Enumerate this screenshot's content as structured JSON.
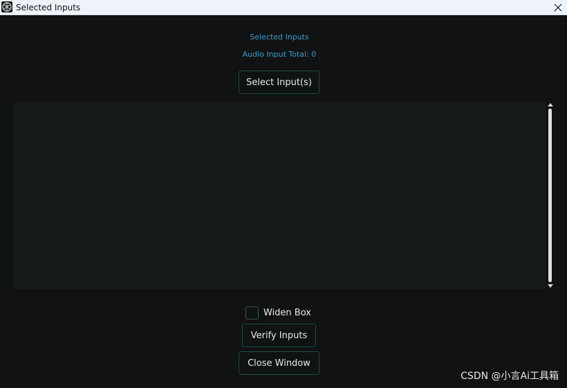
{
  "window": {
    "title": "Selected Inputs"
  },
  "header": {
    "heading": "Selected Inputs",
    "audio_total": "Audio Input Total: 0"
  },
  "buttons": {
    "select_inputs": "Select Input(s)",
    "verify_inputs": "Verify Inputs",
    "close_window": "Close Window"
  },
  "options": {
    "widen_box_label": "Widen Box",
    "widen_box_checked": false
  },
  "inputs_list": [],
  "watermark": "CSDN @小言Ai工具箱",
  "icons": {
    "app": "app-logo-icon",
    "close": "close-icon",
    "scroll_up": "scroll-up-arrow-icon",
    "scroll_down": "scroll-down-arrow-icon"
  },
  "colors": {
    "background": "#101213",
    "accent_text": "#3a9fcf",
    "button_border": "#1f4a40",
    "listbox": "#141b1a"
  }
}
